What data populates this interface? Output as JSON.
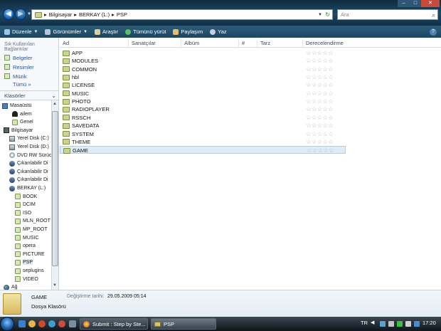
{
  "address": {
    "crumbs": [
      "Bilgisayar",
      "BERKAY (L:)",
      "PSP"
    ]
  },
  "search": {
    "placeholder": "Ara"
  },
  "toolbar": {
    "organize": "Düzenle",
    "views": "Görünümler",
    "explore": "Araştır",
    "play_all": "Tümünü yürüt",
    "share": "Paylaşım",
    "burn": "Yaz"
  },
  "sidebar": {
    "favorites_header": "Sık Kullanılan Bağlantılar",
    "favorites": [
      "Belgeler",
      "Resimler",
      "Müzik"
    ],
    "more": "Tümü",
    "folders_header": "Klasörler"
  },
  "tree": [
    {
      "label": "Masaüstü",
      "icon": "desktop-icon"
    },
    {
      "label": "ailem",
      "icon": "user-icon"
    },
    {
      "label": "Genel",
      "icon": "folder-icon"
    },
    {
      "label": "Bilgisayar",
      "icon": "computer-icon"
    },
    {
      "label": "Yerel Disk (C:)",
      "icon": "drive-icon"
    },
    {
      "label": "Yerel Disk (D:)",
      "icon": "drive-icon"
    },
    {
      "label": "DVD RW Sürücü",
      "icon": "dvd-icon"
    },
    {
      "label": "Çıkarılabilir Di",
      "icon": "removable-icon"
    },
    {
      "label": "Çıkarılabilir Di",
      "icon": "removable-icon"
    },
    {
      "label": "Çıkarılabilir Di",
      "icon": "removable-icon"
    },
    {
      "label": "BERKAY (L:)",
      "icon": "removable-icon"
    },
    {
      "label": "BOOK",
      "icon": "folder-icon"
    },
    {
      "label": "DCIM",
      "icon": "folder-icon"
    },
    {
      "label": "ISO",
      "icon": "folder-icon"
    },
    {
      "label": "MLN_ROOT",
      "icon": "folder-icon"
    },
    {
      "label": "MP_ROOT",
      "icon": "folder-icon"
    },
    {
      "label": "MUSIC",
      "icon": "folder-icon"
    },
    {
      "label": "opera",
      "icon": "folder-icon"
    },
    {
      "label": "PICTURE",
      "icon": "folder-icon"
    },
    {
      "label": "PSP",
      "icon": "folder-icon"
    },
    {
      "label": "seplugins",
      "icon": "folder-icon"
    },
    {
      "label": "VIDEO",
      "icon": "folder-icon"
    },
    {
      "label": "Ağ",
      "icon": "network-icon"
    }
  ],
  "columns": [
    "Ad",
    "Sanatçılar",
    "Albüm",
    "#",
    "Tarz",
    "Derecelendirme"
  ],
  "files": [
    "APP",
    "MODULES",
    "COMMON",
    "hbl",
    "LICENSE",
    "MUSIC",
    "PHOTO",
    "RADIOPLAYER",
    "RSSCH",
    "SAVEDATA",
    "SYSTEM",
    "THEME",
    "GAME"
  ],
  "rating_stars": "☆☆☆☆☆",
  "details": {
    "name": "GAME",
    "type": "Dosya Klasörü",
    "modified_label": "Değiştirme tarihi:",
    "modified_value": "29.05.2009 05:14"
  },
  "taskbar": {
    "tasks": [
      "Submit : Step by Ste...",
      "PSP"
    ],
    "lang": "TR",
    "clock": "17:20"
  }
}
